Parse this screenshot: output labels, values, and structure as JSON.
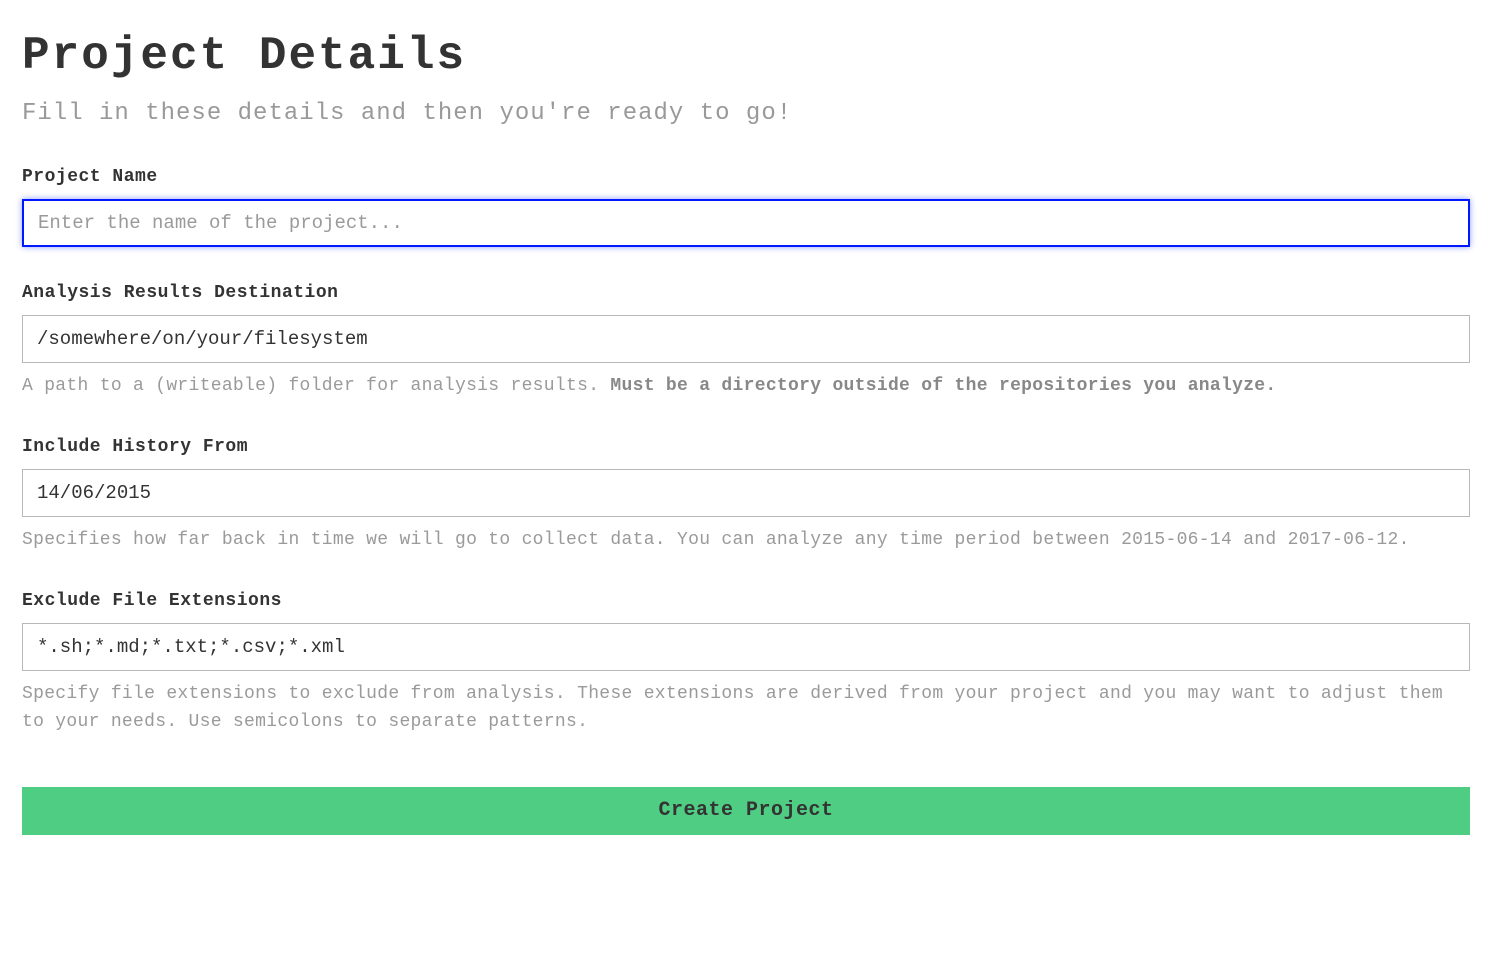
{
  "header": {
    "title": "Project Details",
    "subtitle": "Fill in these details and then you're ready to go!"
  },
  "fields": {
    "project_name": {
      "label": "Project Name",
      "placeholder": "Enter the name of the project...",
      "value": ""
    },
    "results_destination": {
      "label": "Analysis Results Destination",
      "value": "/somewhere/on/your/filesystem",
      "help_plain": "A path to a (writeable) folder for analysis results. ",
      "help_bold": "Must be a directory outside of the repositories you analyze."
    },
    "history_from": {
      "label": "Include History From",
      "value": "14/06/2015",
      "help": "Specifies how far back in time we will go to collect data. You can analyze any time period between 2015-06-14 and 2017-06-12."
    },
    "exclude_extensions": {
      "label": "Exclude File Extensions",
      "value": "*.sh;*.md;*.txt;*.csv;*.xml",
      "help": "Specify file extensions to exclude from analysis. These extensions are derived from your project and you may want to adjust them to your needs. Use semicolons to separate patterns."
    }
  },
  "actions": {
    "create_label": "Create Project"
  }
}
